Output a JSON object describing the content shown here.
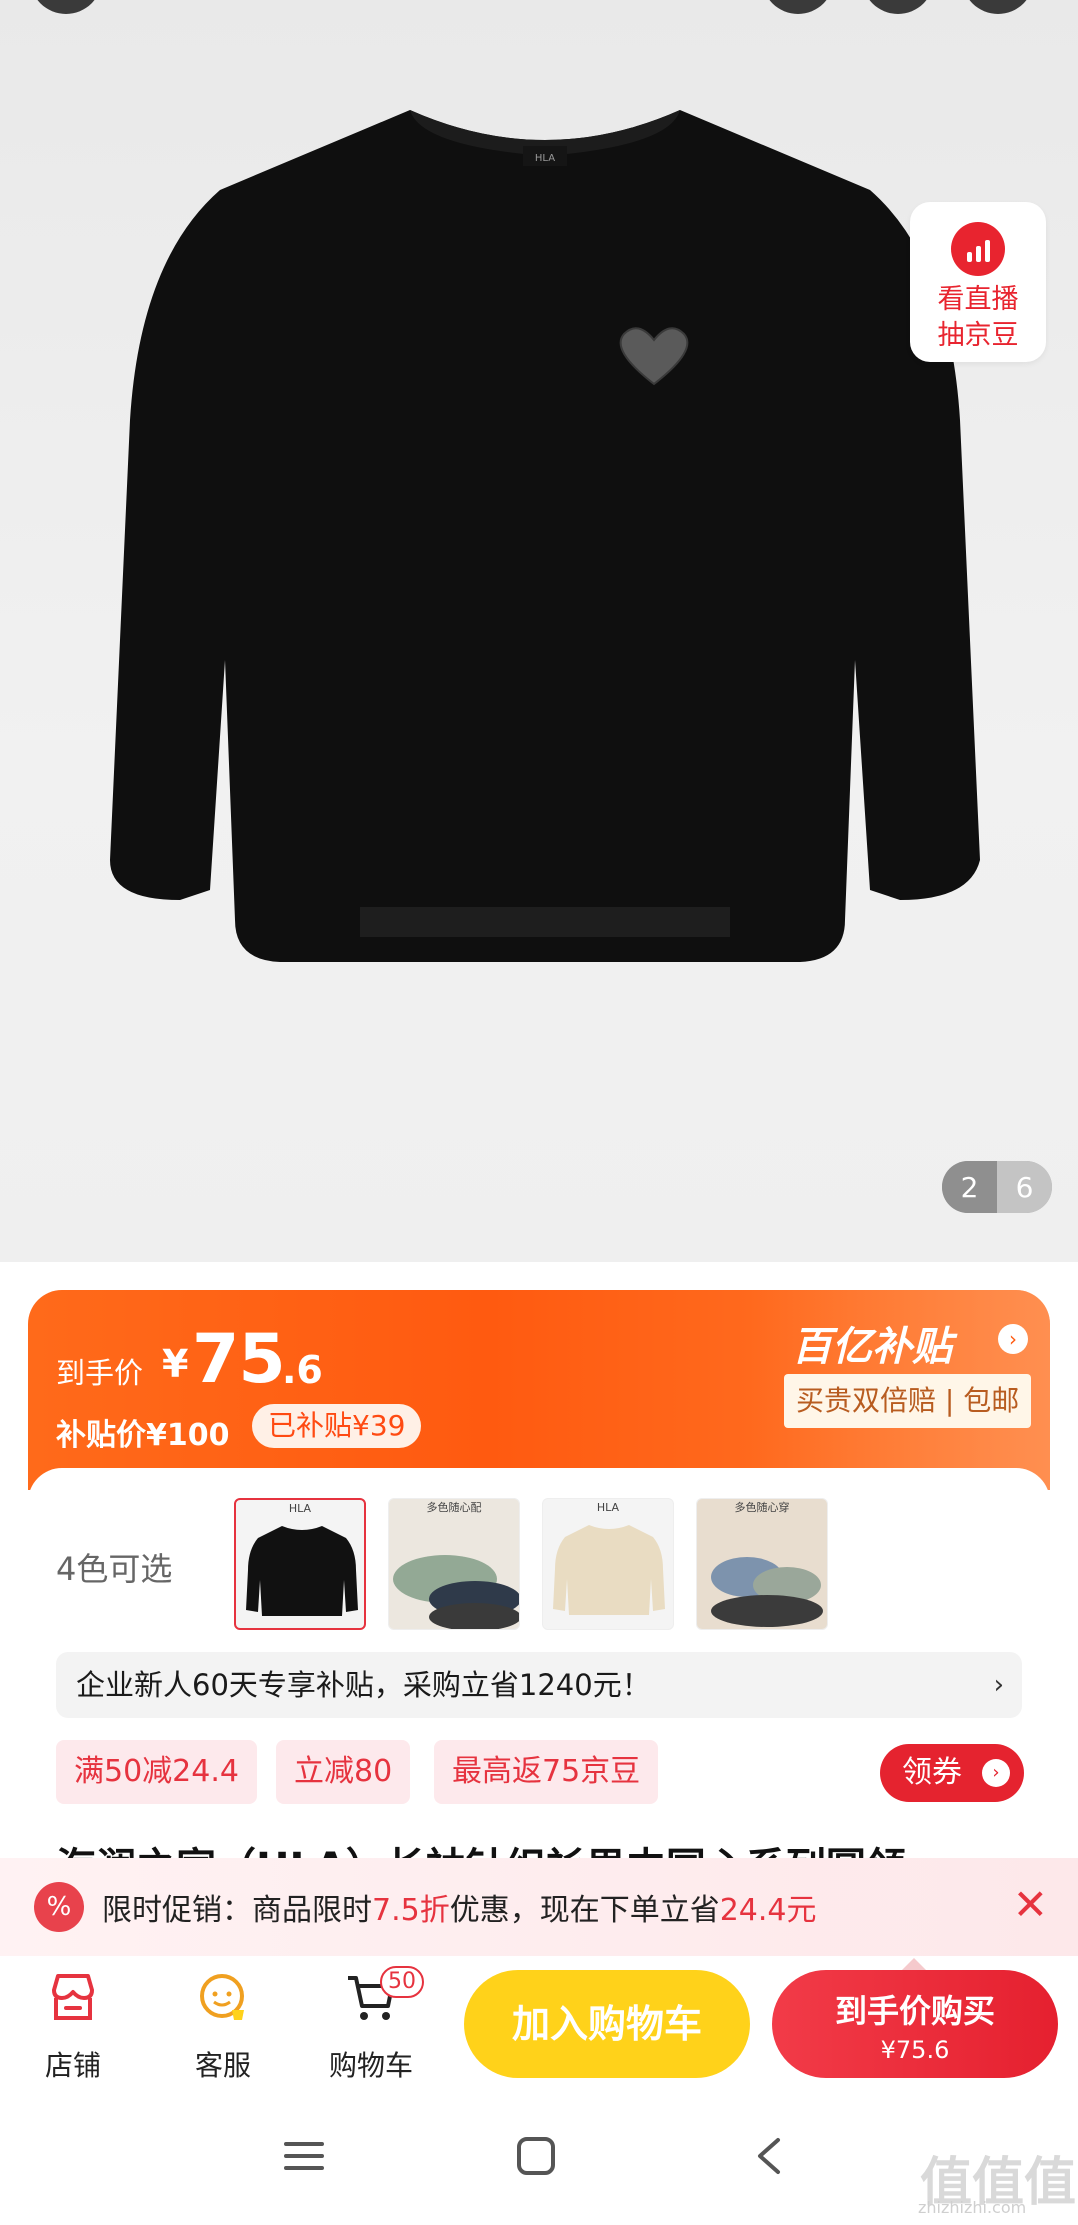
{
  "gallery": {
    "live_card": {
      "line1": "看直播",
      "line2": "抽京豆"
    },
    "page_indicator": {
      "current": "2",
      "total": "6"
    }
  },
  "price_band": {
    "final_label": "到手价",
    "currency": "¥",
    "final_integer": "75",
    "final_decimal": ".6",
    "subsidy_label": "补贴价¥100",
    "subsidy_pill": "已补贴¥39",
    "brand_title": "百亿补贴",
    "brand_tag": "买贵双倍赔 | 包邮"
  },
  "variants": {
    "count_label": "4色可选",
    "thumbs": [
      {
        "name": "black",
        "header": "HLA",
        "selected": true
      },
      {
        "name": "green-stack",
        "header": "多色随心配",
        "selected": false
      },
      {
        "name": "beige",
        "header": "HLA",
        "selected": false
      },
      {
        "name": "multi",
        "header": "多色随心穿",
        "selected": false
      }
    ]
  },
  "notice": {
    "text": "企业新人60天专享补贴，采购立省1240元！",
    "chevron": "›"
  },
  "promos": [
    "满50减24.4",
    "立减80",
    "最高返75京豆"
  ],
  "coupon": {
    "label": "领券",
    "arrow": "›"
  },
  "product_title": "海澜之家（HLA）长袖针织衫男中国心系列圆领",
  "flash": {
    "icon": "%",
    "prefix": "限时促销：商品限时",
    "discount": "7.5折",
    "middle": "优惠，现在下单立省",
    "saving": "24.4元",
    "close": "✕"
  },
  "bottom_bar": {
    "store": "店铺",
    "service": "客服",
    "cart": "购物车",
    "cart_badge": "50",
    "add_to_cart": "加入购物车",
    "buy_label": "到手价购买",
    "buy_price": "¥75.6"
  },
  "watermark": {
    "main": "值值值",
    "sub": "zhizhizhi.com"
  },
  "colors": {
    "accent_red": "#e6333f",
    "orange": "#ff5a10",
    "yellow": "#ffd21a"
  }
}
